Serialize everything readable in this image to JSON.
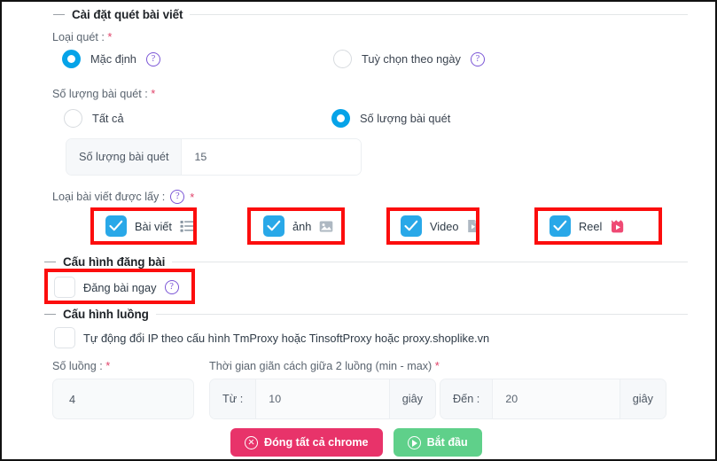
{
  "sections": {
    "scan": {
      "title": "Cài đặt quét bài viết"
    },
    "post": {
      "title": "Cấu hình đăng bài"
    },
    "thread": {
      "title": "Cấu hình luồng"
    }
  },
  "scan": {
    "type_label": "Loại quét :",
    "required_mark": "*",
    "options": [
      {
        "label": "Mặc định",
        "selected": true,
        "help": "?"
      },
      {
        "label": "Tuỳ chọn theo ngày",
        "selected": false,
        "help": "?"
      }
    ],
    "count_label": "Số lượng bài quét :",
    "count_options": [
      {
        "label": "Tất cả",
        "selected": false
      },
      {
        "label": "Số lượng bài quét",
        "selected": true
      }
    ],
    "count_input": {
      "addon": "Số lượng bài quét",
      "value": "15"
    },
    "types_label": "Loại bài viết được lấy :",
    "types_help": "?",
    "types": [
      {
        "label": "Bài viết",
        "checked": true,
        "icon": "article-icon"
      },
      {
        "label": "ảnh",
        "checked": true,
        "icon": "photo-icon"
      },
      {
        "label": "Video",
        "checked": true,
        "icon": "video-file-icon"
      },
      {
        "label": "Reel",
        "checked": true,
        "icon": "reel-icon"
      }
    ]
  },
  "post": {
    "publish_now": {
      "label": "Đăng bài ngay",
      "checked": false,
      "help": "?"
    }
  },
  "thread": {
    "auto_ip": {
      "label": "Tự động đổi IP theo cấu hình TmProxy hoặc TinsoftProxy hoặc proxy.shoplike.vn",
      "checked": false
    },
    "thread_count_label": "Số luồng :",
    "thread_count_value": "4",
    "delay_label": "Thời gian giãn cách giữa 2 luồng (min - max)",
    "delay_from": {
      "addon": "Từ :",
      "value": "10",
      "unit": "giây"
    },
    "delay_to": {
      "addon": "Đến :",
      "value": "20",
      "unit": "giây"
    }
  },
  "buttons": {
    "close_chrome": "Đóng tất cả chrome",
    "start": "Bắt đầu"
  },
  "colors": {
    "accent_blue": "#29a8e8",
    "radio_blue": "#06a3e8",
    "help_purple": "#7b56d6",
    "required_red": "#e0436a",
    "annotation_red": "#fc0d0d",
    "danger_pink": "#e8336a",
    "start_green": "#5fd08a",
    "reel_pink": "#ef4a74"
  }
}
